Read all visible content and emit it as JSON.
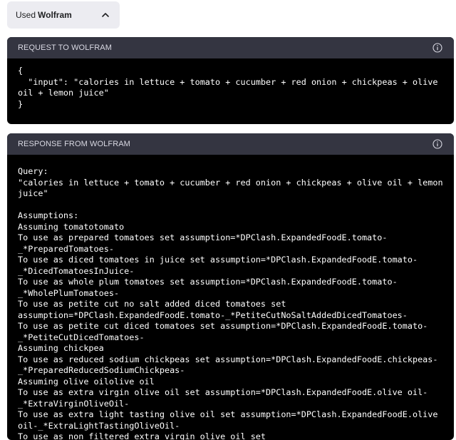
{
  "used_pill": {
    "prefix": "Used",
    "tool": "Wolfram"
  },
  "request": {
    "header": "REQUEST TO WOLFRAM",
    "body": "{\n  \"input\": \"calories in lettuce + tomato + cucumber + red onion + chickpeas + olive\noil + lemon juice\"\n}"
  },
  "response": {
    "header": "RESPONSE FROM WOLFRAM",
    "body": "Query:\n\"calories in lettuce + tomato + cucumber + red onion + chickpeas + olive oil + lemon\njuice\"\n\nAssumptions:\nAssuming tomatotomato\nTo use as prepared tomatoes set assumption=*DPClash.ExpandedFoodE.tomato-\n_*PreparedTomatoes-\nTo use as diced tomatoes in juice set assumption=*DPClash.ExpandedFoodE.tomato-\n_*DicedTomatoesInJuice-\nTo use as whole plum tomatoes set assumption=*DPClash.ExpandedFoodE.tomato-\n_*WholePlumTomatoes-\nTo use as petite cut no salt added diced tomatoes set\nassumption=*DPClash.ExpandedFoodE.tomato-_*PetiteCutNoSaltAddedDicedTomatoes-\nTo use as petite cut diced tomatoes set assumption=*DPClash.ExpandedFoodE.tomato-\n_*PetiteCutDicedTomatoes-\nAssuming chickpea\nTo use as reduced sodium chickpeas set assumption=*DPClash.ExpandedFoodE.chickpeas-\n_*PreparedReducedSodiumChickpeas-\nAssuming olive oilolive oil\nTo use as extra virgin olive oil set assumption=*DPClash.ExpandedFoodE.olive oil-\n_*ExtraVirginOliveOil-\nTo use as extra light tasting olive oil set assumption=*DPClash.ExpandedFoodE.olive\noil-_*ExtraLightTastingOliveOil-\nTo use as non filtered extra virgin olive oil set"
  },
  "icons": {
    "collapse": "chevron-up-icon",
    "info": "info-icon"
  }
}
